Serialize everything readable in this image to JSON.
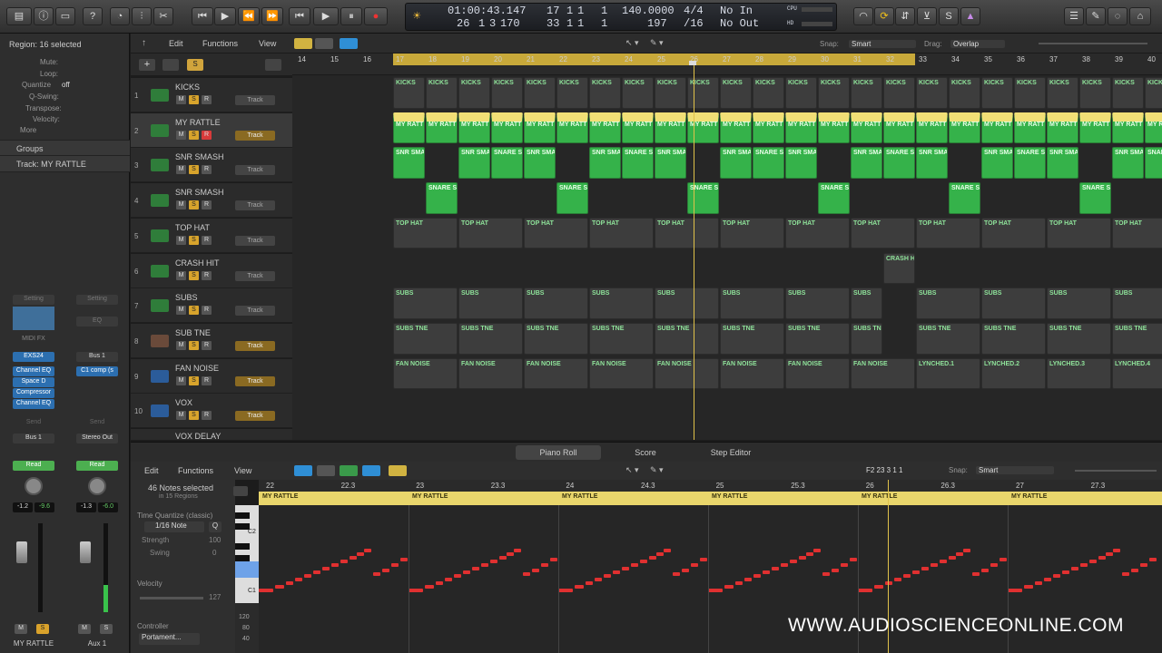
{
  "control_bar": {
    "lcd": {
      "time": "01:00:43.147",
      "bar": "26",
      "beat": "1",
      "div": "3",
      "tick": "170",
      "pos_top": "17",
      "pos_top_b": "1",
      "pos_top_c": "1",
      "pos_top_d": "1",
      "pos_bot": "33",
      "pos_bot_b": "1",
      "pos_bot_c": "1",
      "pos_bot_d": "1",
      "tempo": "140.0000",
      "tempo_bot": "197",
      "sig": "4/4",
      "div_bot": "/16",
      "in": "No In",
      "out": "No Out",
      "cpu": "CPU",
      "hd": "HD"
    }
  },
  "inspector": {
    "region_header": "Region: 16 selected",
    "mute": "Mute:",
    "loop": "Loop:",
    "quantize": "Quantize",
    "quantize_val": "off",
    "qswing": "Q-Swing:",
    "transpose": "Transpose:",
    "velocity": "Velocity:",
    "more": "More",
    "groups": "Groups",
    "track_header": "Track:  MY RATTLE",
    "setting1": "Setting",
    "setting2": "Setting",
    "eq": "EQ",
    "midi_fx": "MIDI FX",
    "instrument": "EXS24",
    "bus_slot": "Bus 1",
    "plugins": [
      "Channel EQ",
      "Space D",
      "Compressor",
      "Channel EQ"
    ],
    "plugin_r": "C1 comp (s",
    "send1": "Send",
    "send2": "Send",
    "bus_out": "Bus 1",
    "stereo_out": "Stereo Out",
    "read1": "Read",
    "read2": "Read",
    "vol1": "-1.2",
    "pk1": "-9.6",
    "vol2": "-1.3",
    "pk2": "-6.0",
    "m": "M",
    "s": "S",
    "name1": "MY RATTLE",
    "name2": "Aux 1"
  },
  "toolbar": {
    "edit": "Edit",
    "functions": "Functions",
    "view": "View",
    "snap_label": "Snap:",
    "snap": "Smart",
    "drag_label": "Drag:",
    "drag": "Overlap",
    "s_button": "S"
  },
  "ruler_bars": [
    "14",
    "15",
    "16",
    "17",
    "18",
    "19",
    "20",
    "21",
    "22",
    "23",
    "24",
    "25",
    "26",
    "27",
    "28",
    "29",
    "30",
    "31",
    "32",
    "33",
    "34",
    "35",
    "36",
    "37",
    "38",
    "39",
    "40"
  ],
  "tracks": [
    {
      "num": "1",
      "name": "KICKS",
      "pill": "Track",
      "rec": false
    },
    {
      "num": "2",
      "name": "MY RATTLE",
      "pill": "Track",
      "rec": true
    },
    {
      "num": "3",
      "name": "SNR SMASH",
      "pill": "Track",
      "rec": false
    },
    {
      "num": "4",
      "name": "SNR SMASH",
      "pill": "Track",
      "rec": false
    },
    {
      "num": "5",
      "name": "TOP HAT",
      "pill": "Track",
      "rec": false
    },
    {
      "num": "6",
      "name": "CRASH HIT",
      "pill": "Track",
      "rec": false
    },
    {
      "num": "7",
      "name": "SUBS",
      "pill": "Track",
      "rec": false
    },
    {
      "num": "8",
      "name": "SUB TNE",
      "pill": "Track",
      "rec": false
    },
    {
      "num": "9",
      "name": "FAN NOISE",
      "pill": "Track",
      "rec": false
    },
    {
      "num": "10",
      "name": "VOX",
      "pill": "Track",
      "rec": false
    }
  ],
  "track_cut_name": "VOX DELAY",
  "regions": {
    "kicks": "KICKS",
    "rattle": "MY RATT",
    "rattle_full": "MY RATTLE",
    "snr": "SNR SMA",
    "snare": "SNARE S",
    "snare_b": "SNARE S",
    "tophat": "TOP HAT",
    "crash": "CRASH H",
    "subs": "SUBS",
    "subtne": "SUBS TNE",
    "subtne_cut": "SUBS TN",
    "fan": "FAN NOISE",
    "lynched": [
      "LYNCHED.1",
      "LYNCHED.2",
      "LYNCHED.3",
      "LYNCHED.4"
    ]
  },
  "piano_roll": {
    "tabs": [
      "Piano Roll",
      "Score",
      "Step Editor"
    ],
    "edit": "Edit",
    "functions": "Functions",
    "view": "View",
    "position": "F2   23 3 1 1",
    "snap_label": "Snap:",
    "snap": "Smart",
    "notes_selected": "46 Notes selected",
    "in_regions": "in 15 Regions",
    "tq_label": "Time Quantize (classic)",
    "tq_val": "1/16 Note",
    "q": "Q",
    "strength": "Strength",
    "strength_val": "100",
    "swing": "Swing",
    "swing_val": "0",
    "velocity": "Velocity",
    "velocity_val": "127",
    "controller": "Controller",
    "controller_val": "Portament...",
    "ruler": [
      "22",
      "22.3",
      "23",
      "23.3",
      "24",
      "24.3",
      "25",
      "25.3",
      "26",
      "26.3",
      "27",
      "27.3"
    ],
    "key_c2": "C2",
    "key_c1": "C1",
    "scale": [
      "120",
      "80",
      "40"
    ]
  },
  "watermark": "WWW.AUDIOSCIENCEONLINE.COM",
  "colors": {
    "green": "#35b24a",
    "yellow": "#f1df76",
    "note": "#e03030",
    "accent": "#2f8fd6"
  }
}
